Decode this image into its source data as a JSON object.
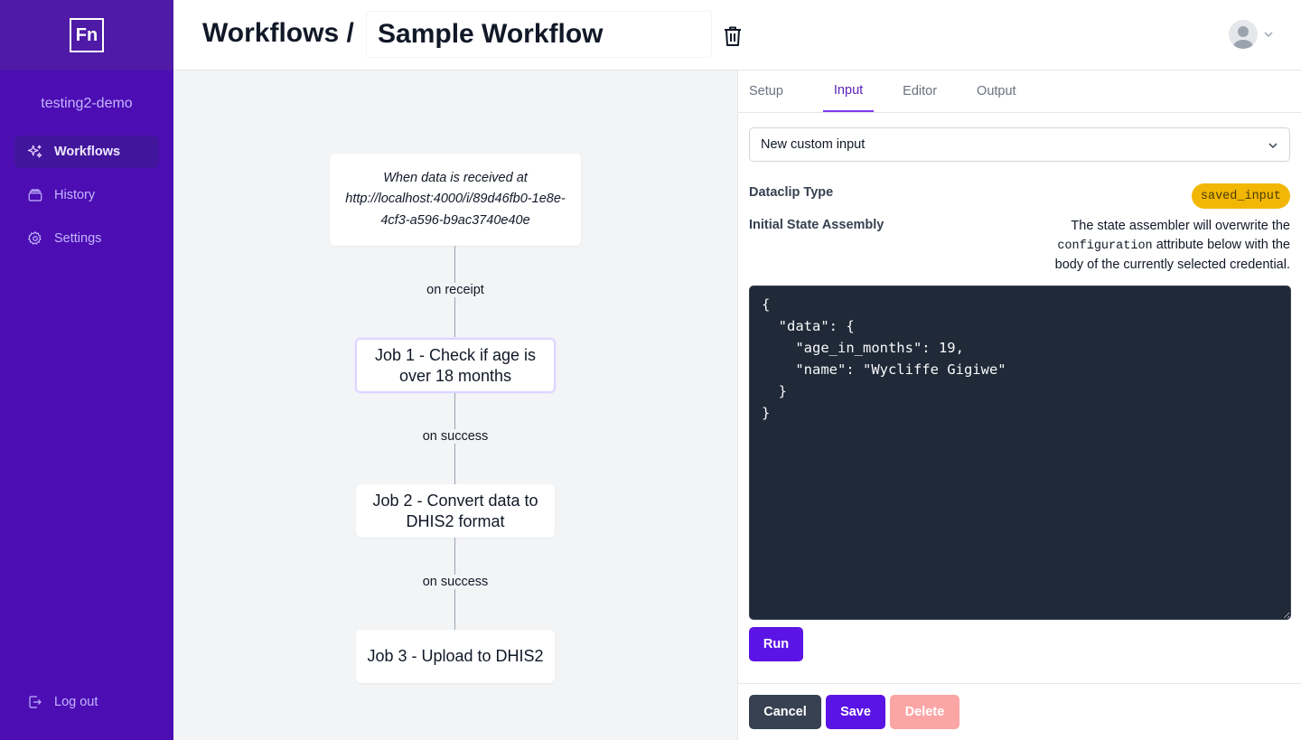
{
  "sidebar": {
    "logo": "Fn",
    "project": "testing2-demo",
    "items": [
      {
        "label": "Workflows",
        "icon": "sparkles-icon",
        "active": true
      },
      {
        "label": "History",
        "icon": "archive-icon",
        "active": false
      },
      {
        "label": "Settings",
        "icon": "gear-icon",
        "active": false
      }
    ],
    "logout": "Log out"
  },
  "header": {
    "breadcrumb": "Workflows /",
    "workflow_name": "Sample Workflow"
  },
  "canvas": {
    "trigger": "When data is received at http://localhost:4000/i/89d46fb0-1e8e-4cf3-a596-b9ac3740e40e",
    "jobs": [
      "Job 1 - Check if age is over 18 months",
      "Job 2 - Convert data to DHIS2 format",
      "Job 3 - Upload to DHIS2"
    ],
    "edges": [
      "on receipt",
      "on success",
      "on success"
    ]
  },
  "panel": {
    "tabs": [
      "Setup",
      "Input",
      "Editor",
      "Output"
    ],
    "active_tab": "Input",
    "input_select": "New custom input",
    "dataclip_label": "Dataclip Type",
    "dataclip_type": "saved_input",
    "state_label": "Initial State Assembly",
    "state_desc_pre": "The state assembler will overwrite the",
    "state_desc_code": "configuration",
    "state_desc_post": "attribute below with the body of the currently selected credential.",
    "editor_text": "{\n  \"data\": {\n    \"age_in_months\": 19,\n    \"name\": \"Wycliffe Gigiwe\"\n  }\n}",
    "run": "Run",
    "cancel": "Cancel",
    "save": "Save",
    "delete": "Delete"
  },
  "colors": {
    "sidebar": "#4c0eb3",
    "accent": "#5b14e6",
    "badge": "#f2b705",
    "editor_bg": "#1f2937",
    "delete_disabled": "#fca5a5"
  }
}
